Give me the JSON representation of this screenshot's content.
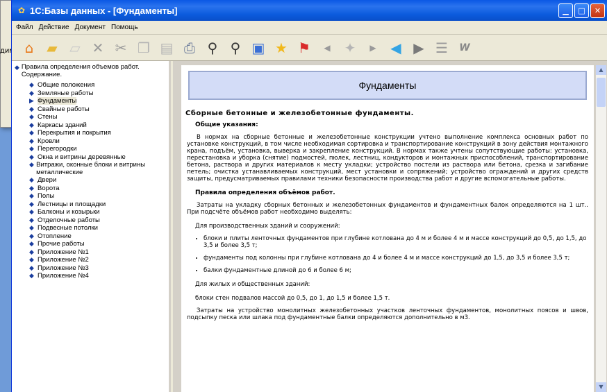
{
  "background_fragment": "дим",
  "window": {
    "title": "1С:Базы данных - [Фундаменты]"
  },
  "menu": [
    "Файл",
    "Действие",
    "Документ",
    "Помощь"
  ],
  "toolbar_icons": [
    "home-icon",
    "open-folder-icon",
    "new-folder-icon",
    "delete-icon",
    "cut-icon",
    "copy-icon",
    "paste-icon",
    "print-icon",
    "find-icon",
    "find-next-icon",
    "preview-icon",
    "favorite-star-icon",
    "flag-icon",
    "back-small-icon",
    "hint-icon",
    "forward-small-icon",
    "back-icon",
    "forward-icon",
    "structure-icon",
    "word-icon"
  ],
  "tree": {
    "root": "Правила определения объемов работ. Содержание.",
    "items": [
      {
        "label": "Общие положения",
        "selected": false
      },
      {
        "label": "Земляные работы",
        "selected": false
      },
      {
        "label": "Фундаменты",
        "selected": true
      },
      {
        "label": "Свайные работы",
        "selected": false
      },
      {
        "label": "Стены",
        "selected": false
      },
      {
        "label": "Каркасы зданий",
        "selected": false
      },
      {
        "label": "Перекрытия и покрытия",
        "selected": false
      },
      {
        "label": "Кровли",
        "selected": false
      },
      {
        "label": "Перегородки",
        "selected": false
      },
      {
        "label": "Окна и витрины деревянные",
        "selected": false
      },
      {
        "label": "Витражи, оконные блоки и витрины металлические",
        "selected": false
      },
      {
        "label": "Двери",
        "selected": false
      },
      {
        "label": "Ворота",
        "selected": false
      },
      {
        "label": "Полы",
        "selected": false
      },
      {
        "label": "Лестницы и площадки",
        "selected": false
      },
      {
        "label": "Балконы и козырьки",
        "selected": false
      },
      {
        "label": "Отделочные работы",
        "selected": false
      },
      {
        "label": "Подвесные потолки",
        "selected": false
      },
      {
        "label": "Отопление",
        "selected": false
      },
      {
        "label": "Прочие работы",
        "selected": false
      },
      {
        "label": "Приложение №1",
        "selected": false
      },
      {
        "label": "Приложение №2",
        "selected": false
      },
      {
        "label": "Приложение №3",
        "selected": false
      },
      {
        "label": "Приложение №4",
        "selected": false
      }
    ]
  },
  "doc": {
    "header": "Фундаменты",
    "h2": "Сборные бетонные и железобетонные фундаменты.",
    "h3_general": "Общие указания:",
    "p_general": "В нормах на сборные бетонные и железобетонные конструкции учтено выполнение комплекса основных работ по установке конструкций, в том числе необходимая сортировка и транспортирование конструкций в зону действия монтажного крана, подъём, установка, выверка и закрепление конструкций. В нормах также учтены сопутствующие работы: установка, перестановка и уборка (снятие) подмостей, пюлек, лестниц, кондукторов и монтажных приспособлений, транспортирование бетона, раствора и других материалов к месту укладки; устройство постели из раствора или бетона, срезка и загибание петель; очистка устанавливаемых конструкций, мест установки и сопряжений; устройство ограждений и других средств защиты, предусматриваемых правилами техники безопасности производства работ и другие вспомогательные работы.",
    "h3_rules": "Правила определения объёмов работ.",
    "p_rules": "Затраты на укладку сборных бетонных и железобетонных фундаментов и фундаментных балок определяются на 1 шт.. При подсчёте объёмов работ необходимо выделять:",
    "p_industrial": "Для производственных зданий и сооружений:",
    "list": [
      "блоки и плиты ленточных фундаментов при глубине котлована до 4 м и более 4 м и массе конструкций до 0,5, до 1,5, до 3,5 и более 3,5 т;",
      "фундаменты под колонны при глубине котлована до 4 и более 4 м и массе конструкций до 1,5, до 3,5 и более 3,5 т;",
      "балки фундаментные длиной до 6 и более 6 м;"
    ],
    "p_residential": "Для жилых и общественных зданий:",
    "p_blocks": "блоки стен подвалов массой до 0,5, до 1, до 1,5 и более 1,5 т.",
    "p_monolith": "Затраты на устройство монолитных железобетонных участков ленточных фундаментов, монолитных поясов и швов, подсыпку песка или шлака под фундаментные балки определяются дополнительно в м3."
  }
}
